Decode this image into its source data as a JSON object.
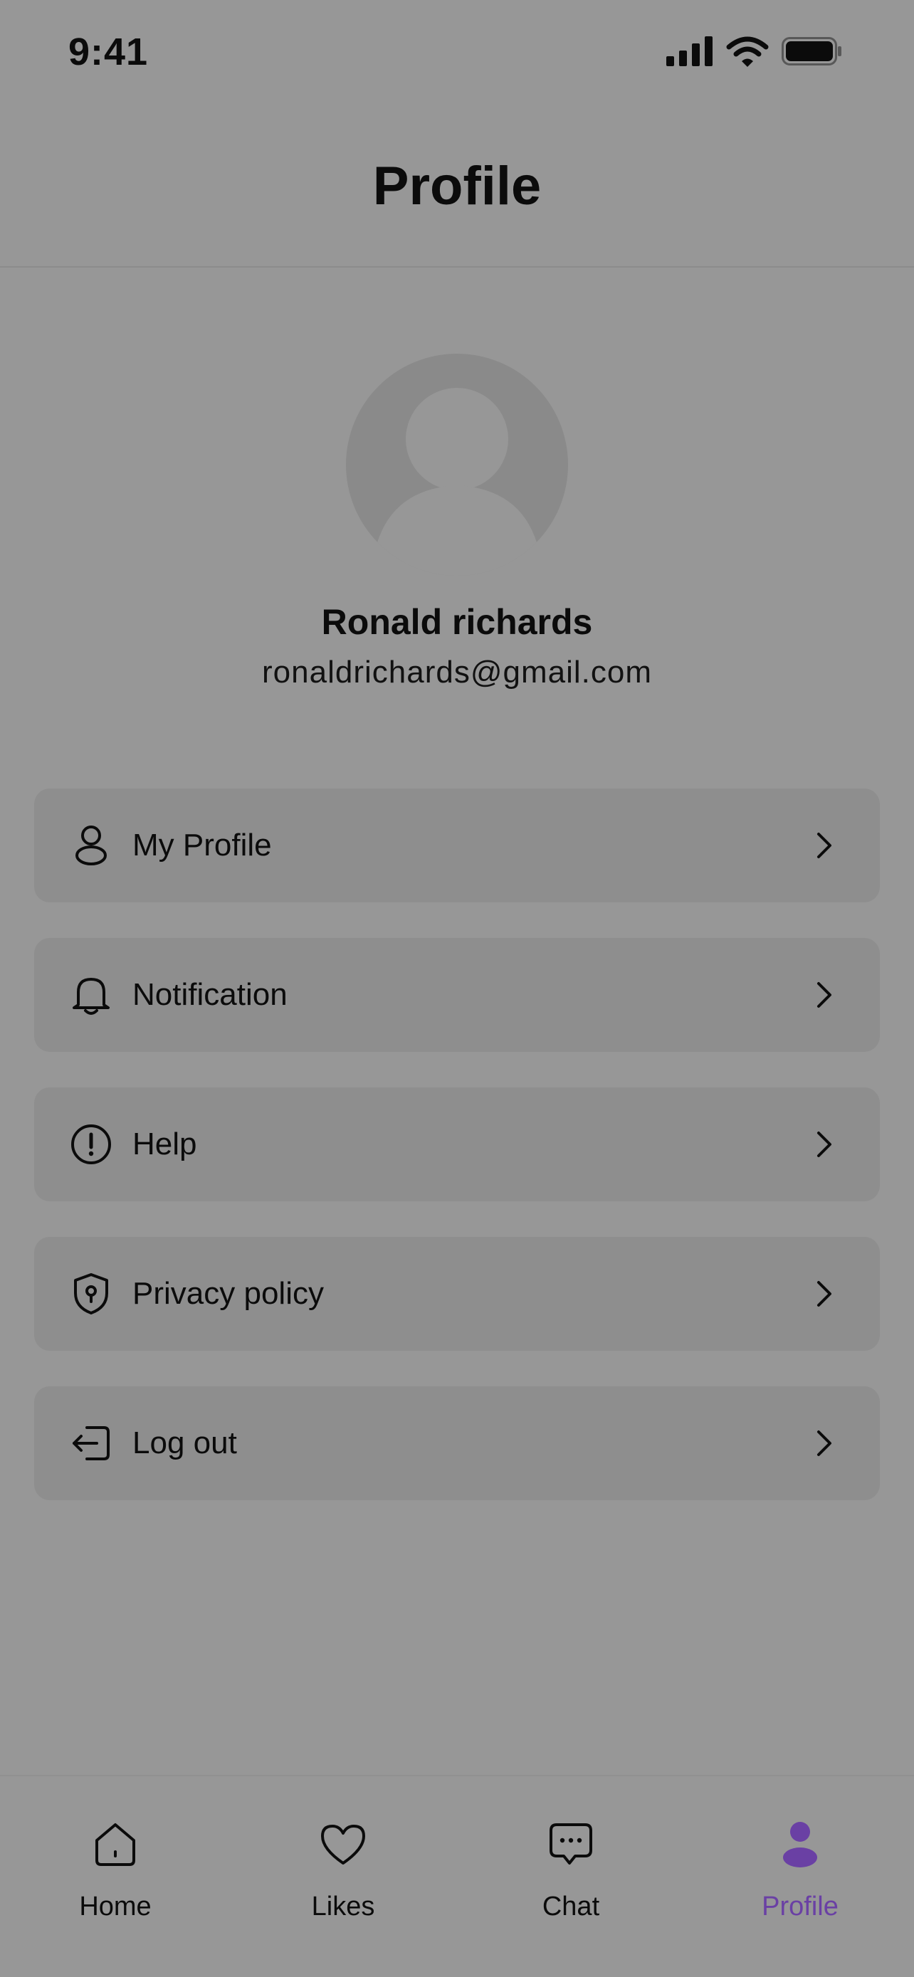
{
  "status_bar": {
    "time": "9:41"
  },
  "header": {
    "title": "Profile"
  },
  "profile": {
    "name": "Ronald richards",
    "email": "ronaldrichards@gmail.com",
    "avatar_icon": "user-silhouette-icon"
  },
  "menu": {
    "items": [
      {
        "label": "My Profile",
        "icon": "user-icon"
      },
      {
        "label": "Notification",
        "icon": "bell-icon"
      },
      {
        "label": "Help",
        "icon": "info-circle-icon"
      },
      {
        "label": "Privacy policy",
        "icon": "shield-icon"
      },
      {
        "label": "Log out",
        "icon": "logout-icon"
      }
    ]
  },
  "bottom_nav": {
    "items": [
      {
        "label": "Home",
        "icon": "home-icon",
        "active": false
      },
      {
        "label": "Likes",
        "icon": "heart-icon",
        "active": false
      },
      {
        "label": "Chat",
        "icon": "chat-icon",
        "active": false
      },
      {
        "label": "Profile",
        "icon": "profile-icon",
        "active": true
      }
    ]
  },
  "colors": {
    "background": "#979797",
    "card": "#8e8e8e",
    "text": "#0b0b0b",
    "accent": "#6a40a4"
  }
}
